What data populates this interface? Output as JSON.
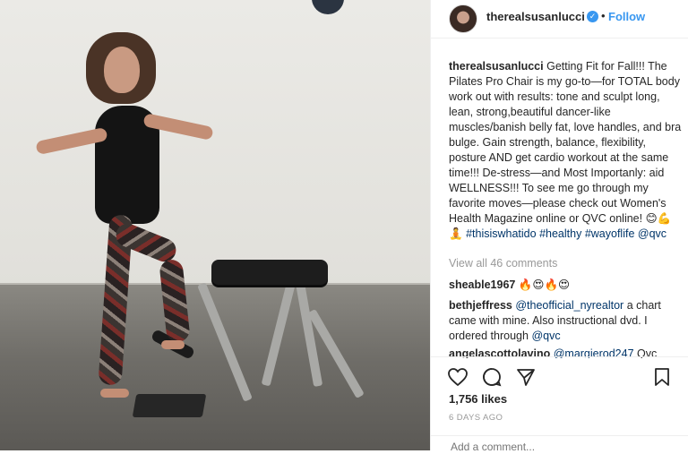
{
  "post": {
    "username": "therealsusanlucci",
    "verified_icon": "verified-badge-icon",
    "follow_label": "Follow",
    "dot": "•",
    "caption": {
      "username": "therealsusanlucci",
      "text": "Getting Fit for Fall!!! The Pilates Pro Chair is my go-to—for TOTAL body work out with results: tone and sculpt long, lean, strong,beautiful dancer-like muscles/banish belly fat, love handles, and bra bulge. Gain strength, balance, flexibility, posture AND get cardio workout at the same time!!! De-stress—and Most Importanly: aid WELLNESS!!! To see me go through my favorite moves—please check out Women's Health Magazine online or QVC online! 😊💪🧘",
      "hashtags": [
        "#thisiswhatido",
        "#healthy",
        "#wayoflife",
        "@qvc"
      ]
    },
    "view_all_comments": "View all 46 comments",
    "comments": [
      {
        "user": "sheable1967",
        "text": "🔥😍🔥😍"
      },
      {
        "user": "bethjeffress",
        "mention": "@theofficial_nyrealtor",
        "text": "a chart came with mine. Also instructional dvd. I ordered through",
        "mention2": "@qvc"
      },
      {
        "user": "angelascottolavino",
        "mention": "@margierod247",
        "text": "Qvc"
      }
    ],
    "likes": "1,756 likes",
    "timestamp": "6 DAYS AGO",
    "add_comment_placeholder": "Add a comment..."
  },
  "icons": {
    "like": "heart-icon",
    "comment": "comment-icon",
    "share": "share-icon",
    "save": "bookmark-icon"
  },
  "colors": {
    "link_blue": "#3897f0",
    "hashtag": "#003569",
    "muted": "#999999",
    "text": "#262626"
  }
}
